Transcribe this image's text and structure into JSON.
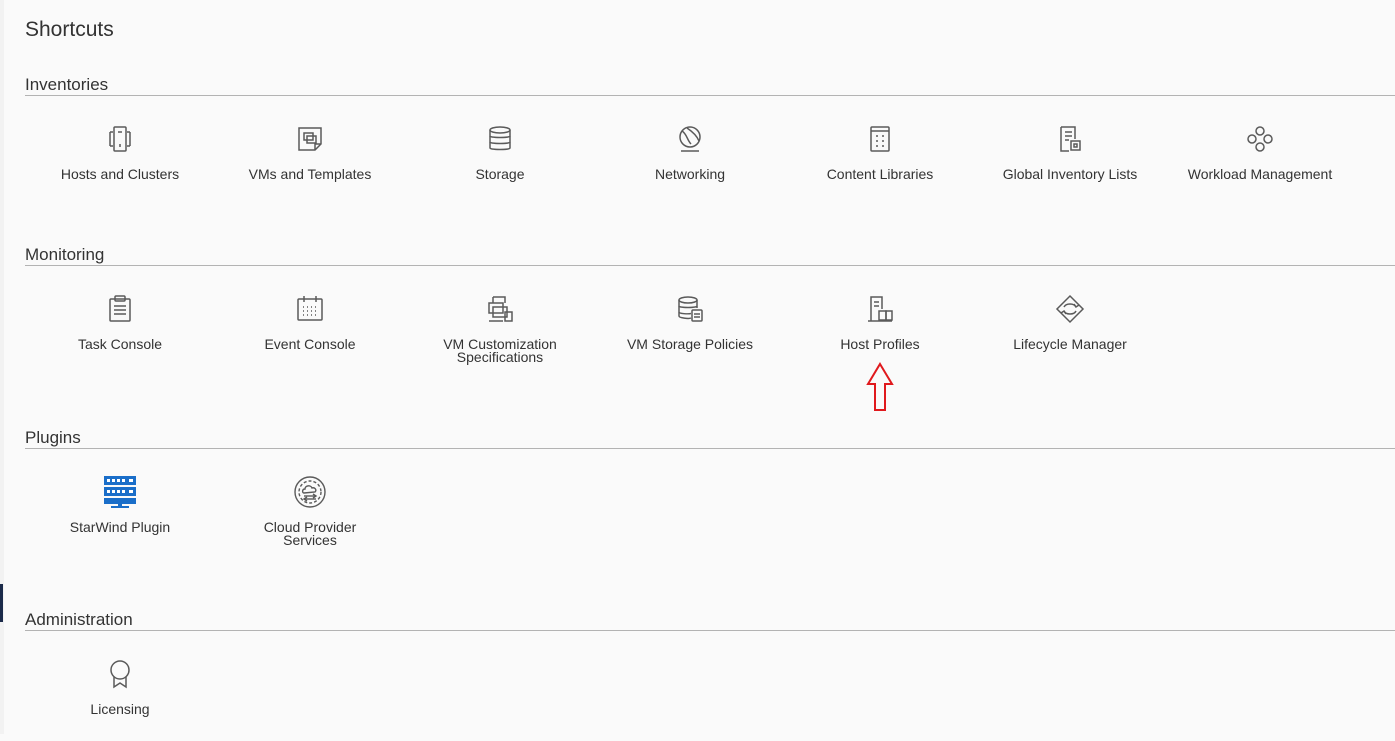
{
  "page": {
    "title": "Shortcuts"
  },
  "sections": {
    "inventories": {
      "title": "Inventories",
      "items": [
        {
          "label": "Hosts and Clusters",
          "icon": "hosts-clusters-icon"
        },
        {
          "label": "VMs and Templates",
          "icon": "vms-templates-icon"
        },
        {
          "label": "Storage",
          "icon": "storage-icon"
        },
        {
          "label": "Networking",
          "icon": "networking-icon"
        },
        {
          "label": "Content Libraries",
          "icon": "content-libraries-icon"
        },
        {
          "label": "Global Inventory Lists",
          "icon": "global-inventory-icon"
        },
        {
          "label": "Workload Management",
          "icon": "workload-management-icon"
        }
      ]
    },
    "monitoring": {
      "title": "Monitoring",
      "items": [
        {
          "label": "Task Console",
          "icon": "task-console-icon"
        },
        {
          "label": "Event Console",
          "icon": "event-console-icon"
        },
        {
          "label": "VM Customization Specifications",
          "icon": "vm-customization-icon"
        },
        {
          "label": "VM Storage Policies",
          "icon": "vm-storage-policies-icon"
        },
        {
          "label": "Host Profiles",
          "icon": "host-profiles-icon"
        },
        {
          "label": "Lifecycle Manager",
          "icon": "lifecycle-manager-icon"
        }
      ]
    },
    "plugins": {
      "title": "Plugins",
      "items": [
        {
          "label": "StarWind Plugin",
          "icon": "starwind-plugin-icon"
        },
        {
          "label": "Cloud Provider Services",
          "icon": "cloud-provider-icon"
        }
      ]
    },
    "administration": {
      "title": "Administration",
      "items": [
        {
          "label": "Licensing",
          "icon": "licensing-icon"
        }
      ]
    }
  },
  "colors": {
    "icon": "#5a5a5a",
    "plugin_icon": "#1a6ec9",
    "annotation_arrow": "#e0191d"
  }
}
